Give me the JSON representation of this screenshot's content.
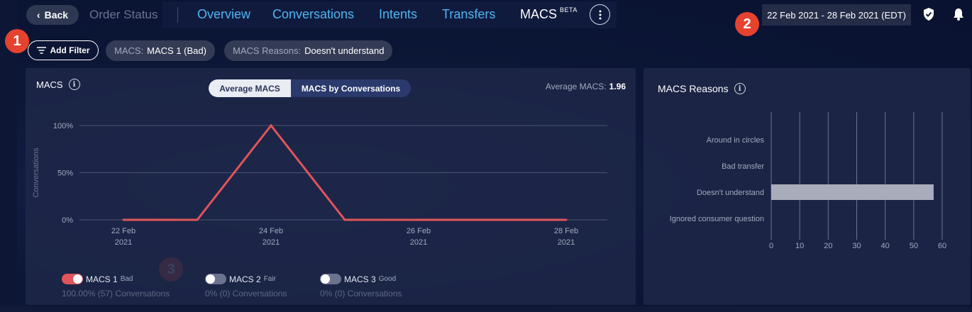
{
  "header": {
    "back_label": "Back",
    "breadcrumb": "Order Status",
    "tabs": [
      {
        "label": "Overview"
      },
      {
        "label": "Conversations"
      },
      {
        "label": "Intents"
      },
      {
        "label": "Transfers"
      },
      {
        "label": "MACS",
        "badge": "BETA"
      }
    ],
    "active_tab": "MACS",
    "date_range": "22 Feb 2021 - 28 Feb 2021 (EDT)",
    "icons": [
      "chevron-left-icon",
      "more-vertical-icon",
      "shield-check-icon",
      "bell-icon"
    ]
  },
  "markers": [
    "1",
    "2",
    "3"
  ],
  "filters": {
    "add_label": "Add Filter",
    "chips": [
      {
        "key": "MACS:",
        "value": "MACS 1 (Bad)"
      },
      {
        "key": "MACS Reasons:",
        "value": "Doesn't understand"
      }
    ]
  },
  "macs_panel": {
    "title": "MACS",
    "toggle": {
      "options": [
        "Average MACS",
        "MACS by Conversations"
      ],
      "selected": "Average MACS"
    },
    "average_label": "Average MACS:",
    "average_value": "1.96",
    "legend": [
      {
        "name": "MACS 1",
        "tag": "Bad",
        "sub": "100.00% (57) Conversations",
        "on": true
      },
      {
        "name": "MACS 2",
        "tag": "Fair",
        "sub": "0% (0) Conversations",
        "on": false
      },
      {
        "name": "MACS 3",
        "tag": "Good",
        "sub": "0% (0) Conversations",
        "on": false
      }
    ]
  },
  "reasons_panel": {
    "title": "MACS Reasons"
  },
  "colors": {
    "line": "#e0555a",
    "bar": "#a9acbb",
    "accent": "#4fb6f2",
    "marker": "#e5432f"
  },
  "chart_data": [
    {
      "type": "line",
      "title": "MACS",
      "ylabel": "Conversations",
      "xlabel": "",
      "x": [
        "22 Feb 2021",
        "23 Feb 2021",
        "24 Feb 2021",
        "25 Feb 2021",
        "26 Feb 2021",
        "27 Feb 2021",
        "28 Feb 2021"
      ],
      "x_tick_labels": [
        {
          "x": "22 Feb 2021",
          "line1": "22 Feb",
          "line2": "2021"
        },
        {
          "x": "24 Feb 2021",
          "line1": "24 Feb",
          "line2": "2021"
        },
        {
          "x": "26 Feb 2021",
          "line1": "26 Feb",
          "line2": "2021"
        },
        {
          "x": "28 Feb 2021",
          "line1": "28 Feb",
          "line2": "2021"
        }
      ],
      "y_ticks": [
        0,
        50,
        100
      ],
      "y_tick_labels": [
        "0%",
        "50%",
        "100%"
      ],
      "ylim": [
        0,
        100
      ],
      "series": [
        {
          "name": "MACS 1",
          "values": [
            0,
            0,
            100,
            0,
            0,
            0,
            0
          ]
        }
      ],
      "grid": true
    },
    {
      "type": "bar",
      "orientation": "horizontal",
      "title": "MACS Reasons",
      "categories": [
        "Around in circles",
        "Bad transfer",
        "Doesn't understand",
        "Ignored consumer question"
      ],
      "values": [
        0,
        0,
        57,
        0
      ],
      "xlim": [
        0,
        60
      ],
      "x_ticks": [
        0,
        10,
        20,
        30,
        40,
        50,
        60
      ],
      "grid": true
    }
  ]
}
